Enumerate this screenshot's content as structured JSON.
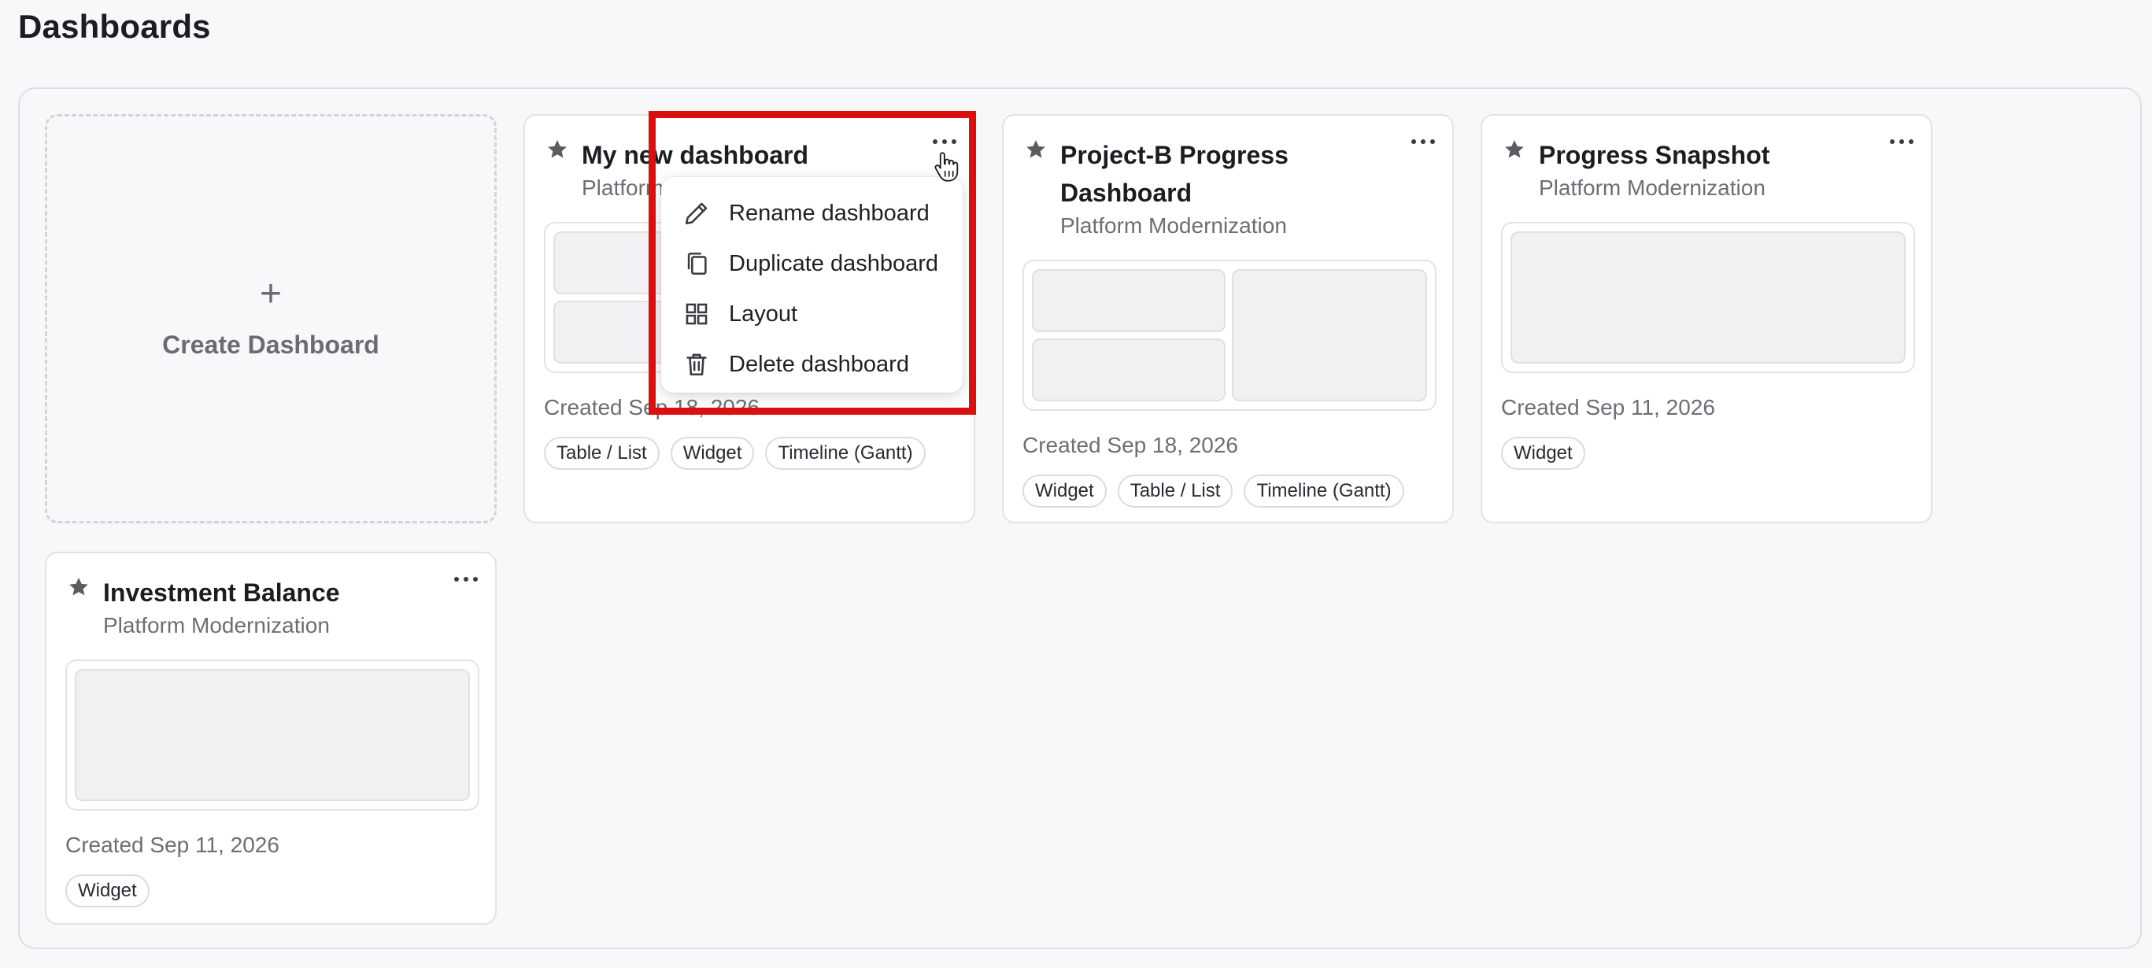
{
  "page": {
    "title": "Dashboards"
  },
  "create": {
    "plus": "+",
    "label": "Create Dashboard"
  },
  "cards": [
    {
      "title": "My new dashboard",
      "subtitle": "Platform Modernization",
      "created": "Created Sep 18, 2026",
      "tags": [
        "Table / List",
        "Widget",
        "Timeline (Gantt)"
      ]
    },
    {
      "title_line1": "Project-B Progress",
      "title_line2": "Dashboard",
      "subtitle": "Platform Modernization",
      "created": "Created Sep 18, 2026",
      "tags": [
        "Widget",
        "Table / List",
        "Timeline (Gantt)"
      ]
    },
    {
      "title": "Progress Snapshot",
      "subtitle": "Platform Modernization",
      "created": "Created Sep 11, 2026",
      "tags": [
        "Widget"
      ]
    },
    {
      "title": "Investment Balance",
      "subtitle": "Platform Modernization",
      "created": "Created Sep 11, 2026",
      "tags": [
        "Widget"
      ]
    }
  ],
  "menu": {
    "items": [
      {
        "label": "Rename dashboard",
        "icon": "pencil-icon"
      },
      {
        "label": "Duplicate dashboard",
        "icon": "copy-icon"
      },
      {
        "label": "Layout",
        "icon": "grid-icon"
      },
      {
        "label": "Delete dashboard",
        "icon": "trash-icon"
      }
    ]
  },
  "colors": {
    "highlight": "#dc0f0f",
    "star": "#5b5c62"
  }
}
